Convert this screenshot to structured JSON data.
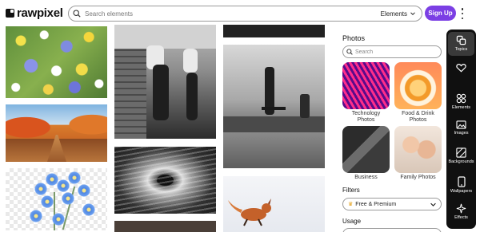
{
  "header": {
    "logo_text": "rawpixel",
    "search_placeholder": "Search elements",
    "search_scope": "Elements",
    "signup_label": "Sign Up"
  },
  "panel": {
    "title": "Photos",
    "search_placeholder": "Search",
    "topics": [
      {
        "label": "Technology Photos"
      },
      {
        "label": "Food & Drink Photos"
      },
      {
        "label": "Business"
      },
      {
        "label": "Family Photos"
      }
    ],
    "filters_label": "Filters",
    "filter_value": "Free & Premium",
    "usage_label": "Usage"
  },
  "toolbar": {
    "items": [
      {
        "label": "Topics",
        "icon": "topics-icon",
        "active": true
      },
      {
        "label": "",
        "icon": "heart-icon"
      },
      {
        "label": "Elements",
        "icon": "elements-icon"
      },
      {
        "label": "Images",
        "icon": "image-icon"
      },
      {
        "label": "Backgrounds",
        "icon": "backgrounds-icon"
      },
      {
        "label": "Wallpapers",
        "icon": "phone-icon"
      },
      {
        "label": "Effects",
        "icon": "sparkle-icon"
      }
    ]
  },
  "colors": {
    "accent": "#7b3fe4",
    "toolbar_bg": "#101010"
  }
}
